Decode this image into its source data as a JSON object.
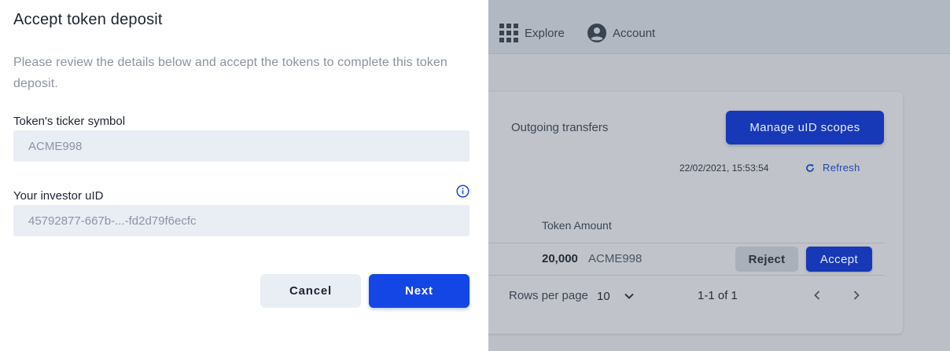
{
  "topbar": {
    "explore_label": "Explore",
    "account_label": "Account"
  },
  "background": {
    "tab_outgoing": "Outgoing transfers",
    "manage_button": "Manage uID scopes",
    "timestamp": "22/02/2021, 15:53:54",
    "refresh_label": "Refresh",
    "table": {
      "column_header": "Token Amount",
      "row": {
        "amount": "20,000",
        "ticker": "ACME998",
        "reject_label": "Reject",
        "accept_label": "Accept"
      }
    },
    "pagination": {
      "rows_per_page_label": "Rows per page",
      "rows_per_page_value": "10",
      "range": "1-1 of 1"
    }
  },
  "dialog": {
    "title": "Accept token deposit",
    "description": "Please review the details below and accept the tokens to complete this token deposit.",
    "ticker_label": "Token's ticker symbol",
    "ticker_value": "ACME998",
    "uid_label": "Your investor uID",
    "uid_value": "45792877-667b-...-fd2d79f6ecfc",
    "cancel_label": "Cancel",
    "next_label": "Next"
  },
  "colors": {
    "primary": "#1446e6",
    "overlay_primary": "#1738b7",
    "field_bg": "#e9eef5"
  }
}
